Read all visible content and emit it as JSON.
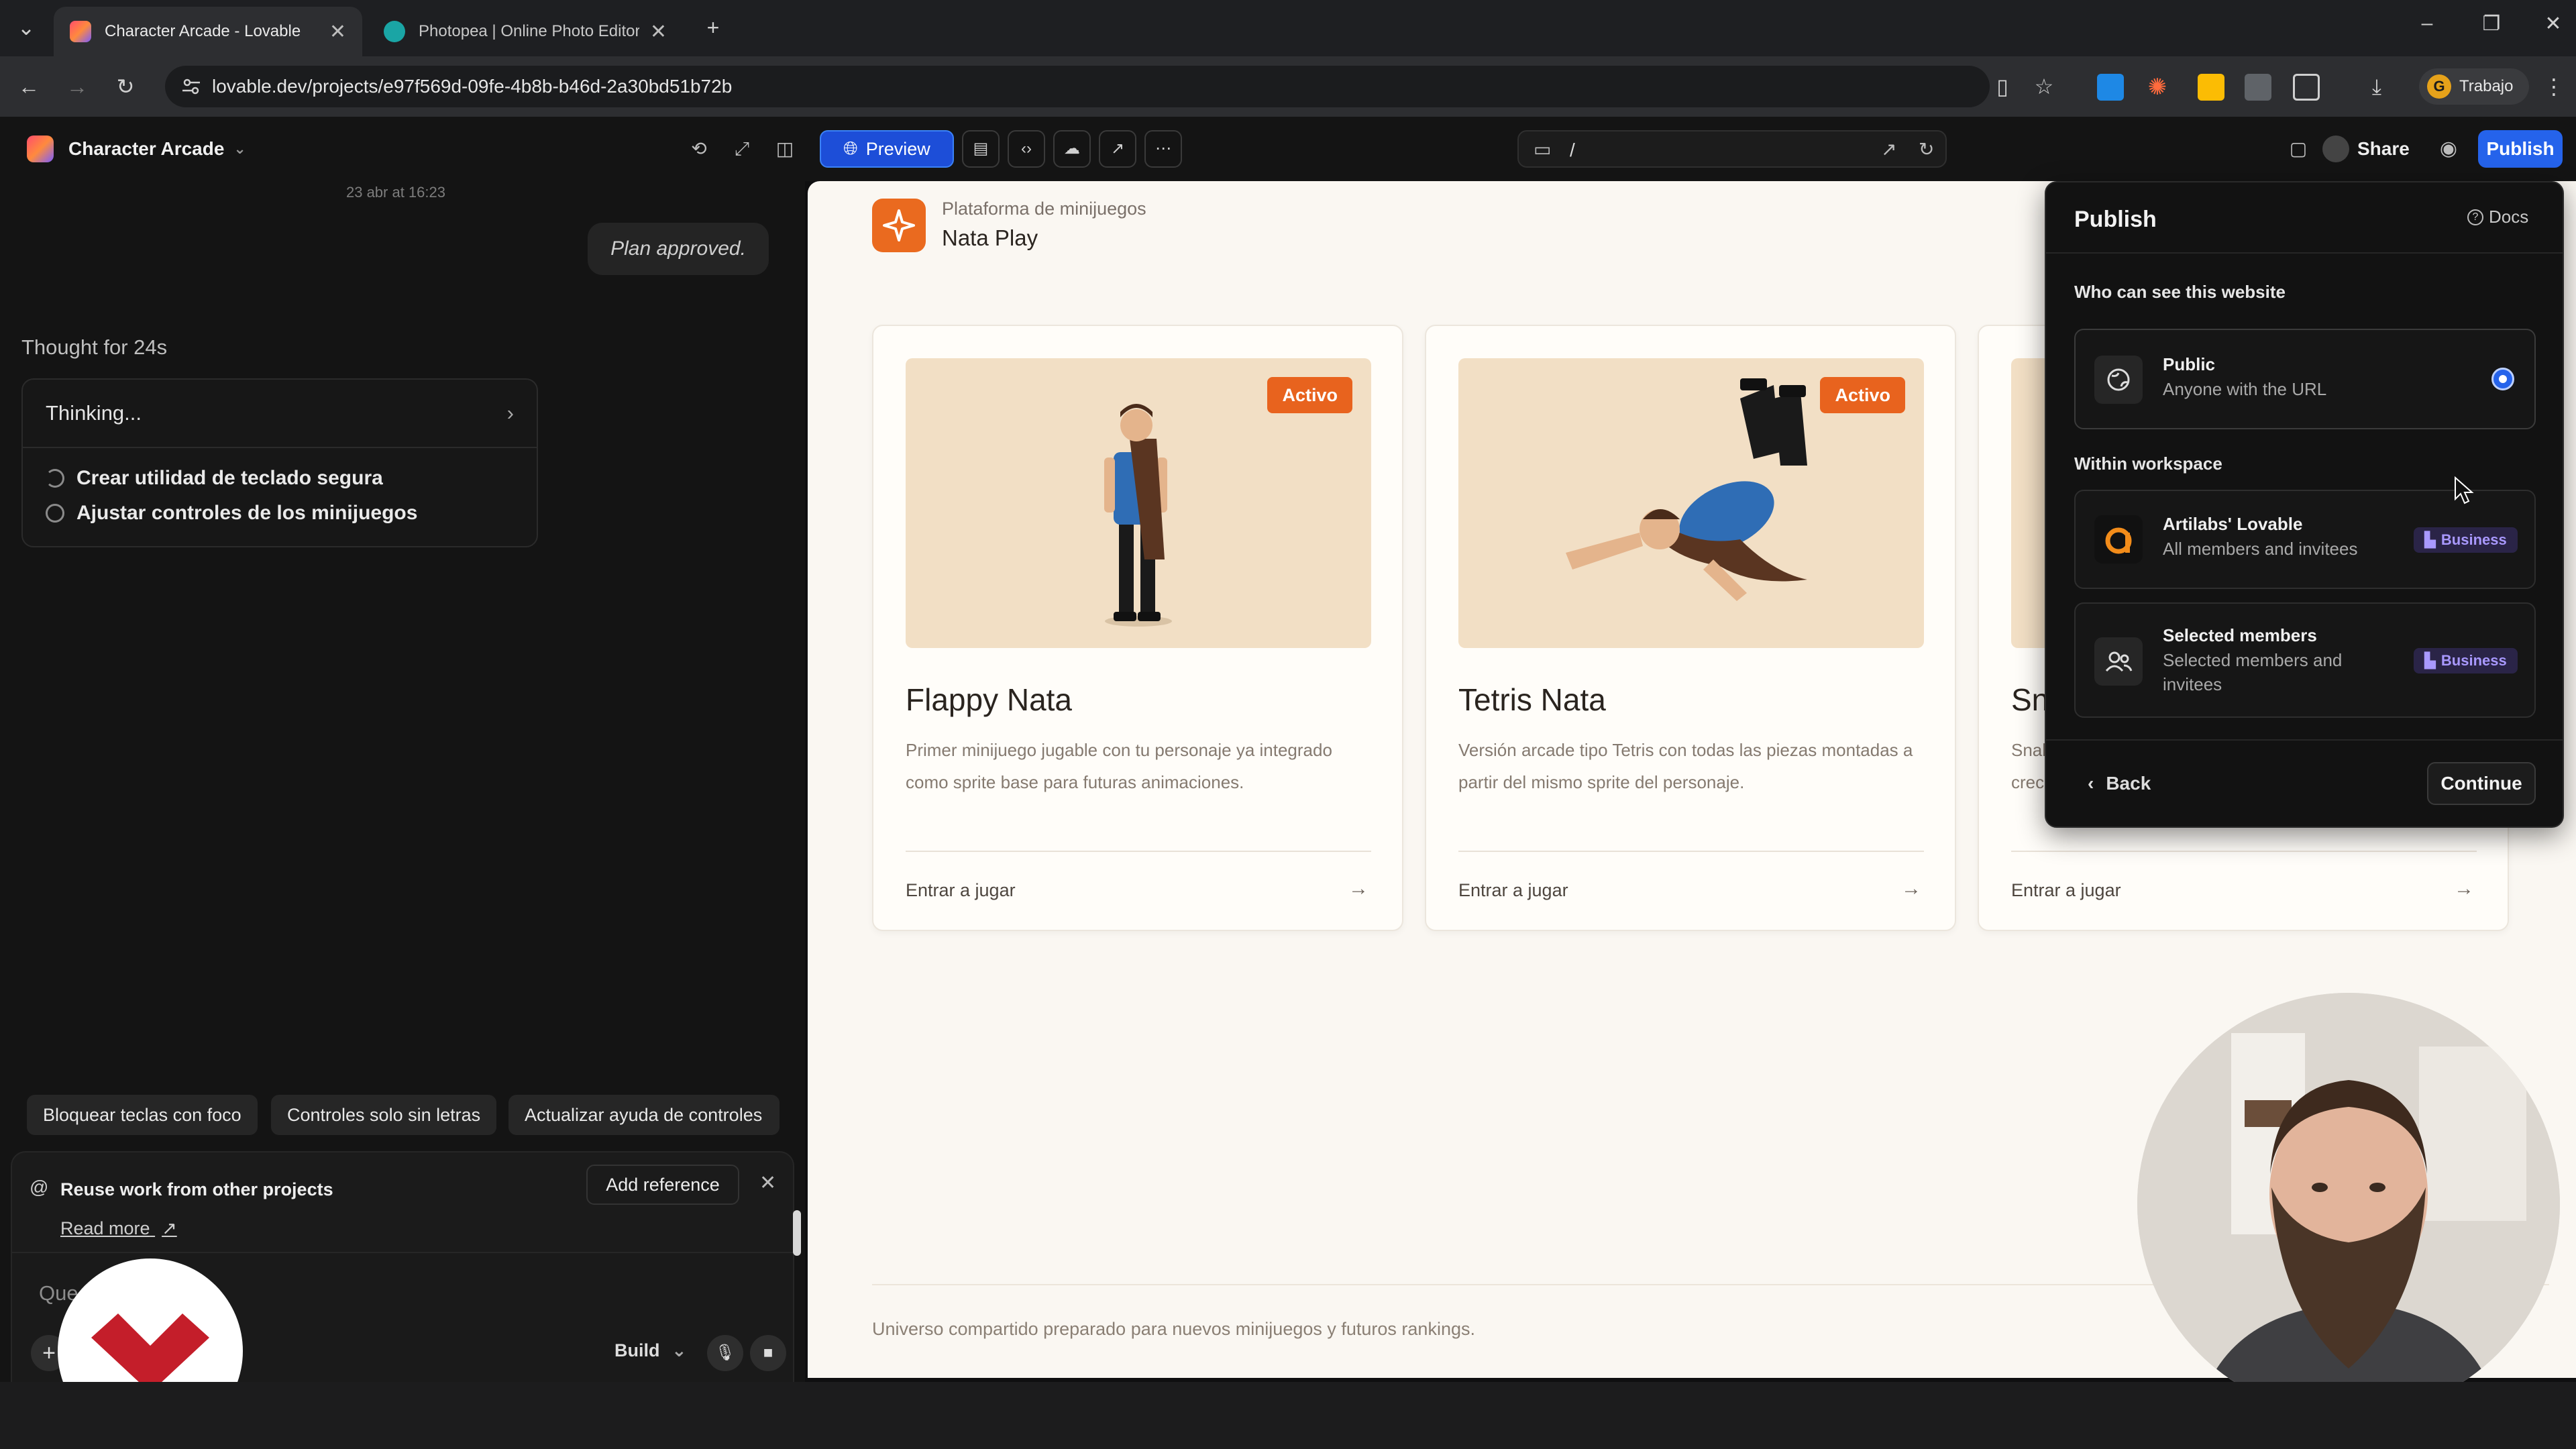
{
  "browser": {
    "tabs": [
      {
        "title": "Character Arcade - Lovable",
        "active": true
      },
      {
        "title": "Photopea | Online Photo Editor",
        "active": false
      }
    ],
    "url": "lovable.dev/projects/e97f569d-09fe-4b8b-b46d-2a30bd51b72b",
    "profile_label": "Trabajo",
    "profile_initial": "G"
  },
  "app": {
    "project_name": "Character Arcade",
    "preview_label": "Preview",
    "route": "/",
    "share_label": "Share",
    "publish_label": "Publish"
  },
  "chat": {
    "timestamp": "23 abr at 16:23",
    "plan_message": "Plan approved.",
    "thought_label": "Thought for 24s",
    "thinking_label": "Thinking...",
    "steps": [
      {
        "label": "Crear utilidad de teclado segura",
        "status": "in-progress"
      },
      {
        "label": "Ajustar controles de los minijuegos",
        "status": "pending"
      }
    ],
    "suggestions": [
      "Bloquear teclas con foco",
      "Controles solo sin letras",
      "Actualizar ayuda de controles"
    ],
    "reuse_title": "Reuse work from other projects",
    "add_reference_label": "Add reference",
    "read_more_label": "Read more",
    "input_placeholder": "Que... p...",
    "mode_label": "Build"
  },
  "preview": {
    "brand_subtitle": "Plataforma de minijuegos",
    "brand_title": "Nata Play",
    "games": [
      {
        "title": "Flappy Nata",
        "badge": "Activo",
        "description": "Primer minijuego jugable con tu personaje ya integrado como sprite base para futuras animaciones.",
        "cta": "Entrar a jugar"
      },
      {
        "title": "Tetris Nata",
        "badge": "Activo",
        "description": "Versión arcade tipo Tetris con todas las piezas montadas a partir del mismo sprite del personaje.",
        "cta": "Entrar a jugar"
      },
      {
        "title": "Sn",
        "badge": "",
        "description": "Snak crec",
        "cta": "Entrar a jugar"
      }
    ],
    "footer_text": "Universo compartido preparado para nuevos minijuegos y futuros rankings."
  },
  "publish": {
    "title": "Publish",
    "docs_label": "Docs",
    "visibility_heading": "Who can see this website",
    "workspace_heading": "Within workspace",
    "options": [
      {
        "name": "Public",
        "description": "Anyone with the URL",
        "selected": true,
        "icon": "globe-icon"
      },
      {
        "name": "Artilabs' Lovable",
        "description": "All members and invitees",
        "badge": "Business",
        "icon": "workspace-logo-icon"
      },
      {
        "name": "Selected members",
        "description": "Selected members and invitees",
        "badge": "Business",
        "icon": "users-icon"
      }
    ],
    "back_label": "Back",
    "continue_label": "Continue"
  },
  "colors": {
    "accent": "#2563eb",
    "badge_orange": "#e8631e",
    "preview_bg": "#faf7f2",
    "app_bg": "#141414"
  }
}
